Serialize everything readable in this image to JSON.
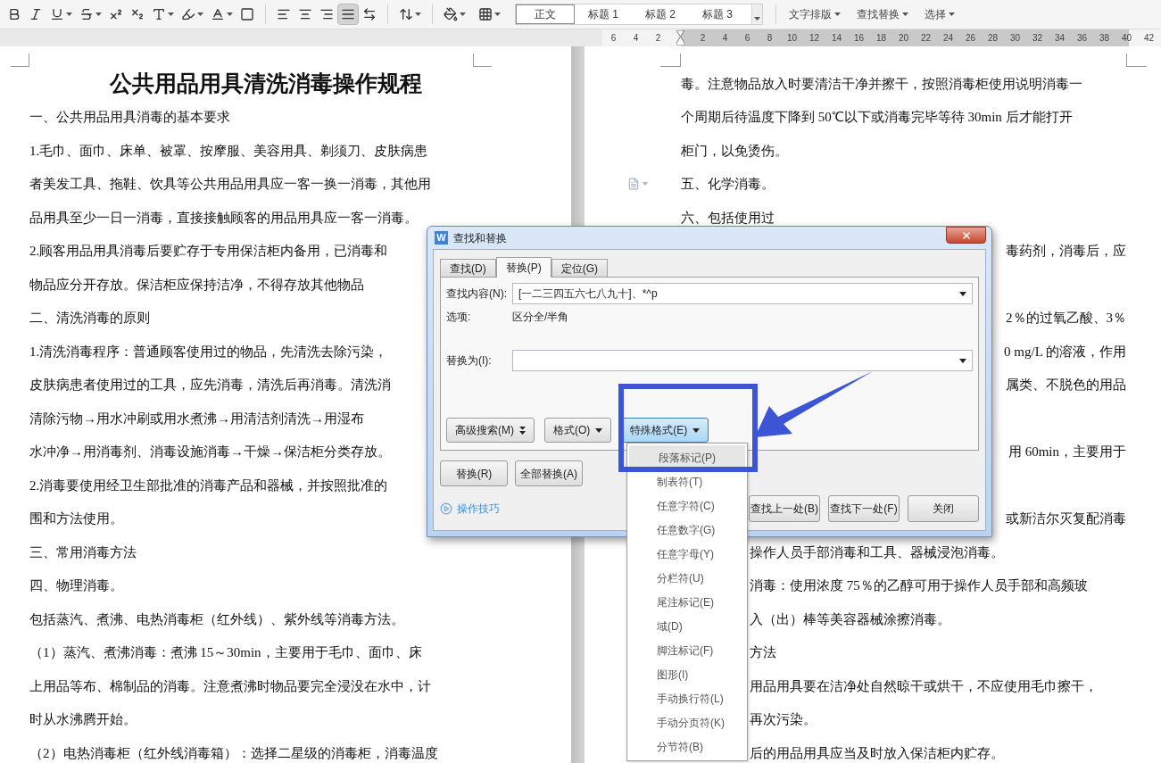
{
  "toolbar": {
    "format_buttons": [
      {
        "kind": "bold"
      },
      {
        "kind": "italic"
      },
      {
        "kind": "underline"
      },
      {
        "kind": "strike"
      },
      {
        "kind": "superscript"
      },
      {
        "kind": "subscript"
      },
      {
        "kind": "outline"
      },
      {
        "kind": "highlight"
      },
      {
        "kind": "font_color"
      },
      {
        "kind": "char_border"
      }
    ],
    "align_buttons": [
      {
        "kind": "left",
        "selected": false
      },
      {
        "kind": "center",
        "selected": false
      },
      {
        "kind": "right",
        "selected": false
      },
      {
        "kind": "justify",
        "selected": true
      },
      {
        "kind": "distribute",
        "selected": false
      }
    ],
    "styles": [
      {
        "label": "正文",
        "selected": true
      },
      {
        "label": "标题 1",
        "selected": false
      },
      {
        "label": "标题 2",
        "selected": false
      },
      {
        "label": "标题 3",
        "selected": false
      }
    ],
    "menus": [
      "文字排版",
      "查找替换",
      "选择"
    ]
  },
  "ruler": {
    "left_ticks": [
      "6",
      "4",
      "2"
    ],
    "right_ticks": [
      "2",
      "4",
      "6",
      "8",
      "10",
      "12",
      "14",
      "16",
      "18",
      "20",
      "22",
      "24",
      "26",
      "28",
      "30",
      "32",
      "34",
      "36",
      "38",
      "40",
      "42"
    ]
  },
  "left_page": {
    "title": "公共用品用具清洗消毒操作规程",
    "lines": [
      "一、公共用品用具消毒的基本要求",
      "1.毛巾、面巾、床单、被罩、按摩服、美容用具、剃须刀、皮肤病患",
      "者美发工具、拖鞋、饮具等公共用品用具应一客一换一消毒，其他用",
      "品用具至少一日一消毒，直接接触顾客的用品用具应一客一消毒。",
      "2.顾客用品用具消毒后要贮存于专用保洁柜内备用，已消毒和",
      "物品应分开存放。保洁柜应保持洁净，不得存放其他物品",
      "二、清洗消毒的原则",
      "1.清洗消毒程序：普通顾客使用过的物品，先清洗去除污染，",
      "皮肤病患者使用过的工具，应先消毒，清洗后再消毒。清洗消",
      "清除污物→用水冲刷或用水煮沸→用清洁剂清洗→用湿布",
      "水冲净→用消毒剂、消毒设施消毒→干燥→保洁柜分类存放。",
      "2.消毒要使用经卫生部批准的消毒产品和器械，并按照批准的",
      "围和方法使用。",
      "三、常用消毒方法",
      "四、物理消毒。",
      "包括蒸汽、煮沸、电热消毒柜（红外线）、紫外线等消毒方法。",
      "（1）蒸汽、煮沸消毒：煮沸 15～30min，主要用于毛巾、面巾、床",
      "上用品等布、棉制品的消毒。注意煮沸时物品要完全浸没在水中，计",
      "时从水沸腾开始。",
      "（2）电热消毒柜（红外线消毒箱）：选择二星级的消毒柜，消毒温度"
    ]
  },
  "right_page": {
    "lines": [
      {
        "kind": "full",
        "text": "毒。注意物品放入时要清洁干净并擦干，按照消毒柜使用说明消毒一"
      },
      {
        "kind": "full",
        "text": "个周期后待温度下降到 50℃以下或消毒完毕等待 30min 后才能打开"
      },
      {
        "kind": "full",
        "text": "柜门，以免烫伤。"
      },
      {
        "kind": "full_with_icon",
        "text": "五、化学消毒。"
      },
      {
        "kind": "full",
        "text": "六、包括使用过"
      },
      {
        "kind": "tail",
        "text": "毒药剂，消毒后，应"
      },
      {
        "kind": "covered"
      },
      {
        "kind": "tail",
        "text": "2％的过氧乙酸、3％"
      },
      {
        "kind": "tail",
        "text": "0 mg/L 的溶液，作用"
      },
      {
        "kind": "tail",
        "text": "属类、不脱色的用品"
      },
      {
        "kind": "covered"
      },
      {
        "kind": "tail",
        "text": "用 60min，主要用于"
      },
      {
        "kind": "covered"
      },
      {
        "kind": "tail",
        "text": "或新洁尔灭复配消毒"
      },
      {
        "kind": "after_menu",
        "text": "操作人员手部消毒和工具、器械浸泡消毒。"
      },
      {
        "kind": "after_menu",
        "text": "消毒：使用浓度 75％的乙醇可用于操作人员手部和高频玻"
      },
      {
        "kind": "after_menu",
        "text": "入（出）棒等美容器械涂擦消毒。"
      },
      {
        "kind": "after_menu",
        "text": "方法"
      },
      {
        "kind": "after_menu",
        "text": "用品用具要在洁净处自然晾干或烘干，不应使用毛巾擦干，"
      },
      {
        "kind": "after_menu",
        "text": "再次污染。"
      },
      {
        "kind": "after_menu",
        "text": "后的用品用具应当及时放入保洁柜内贮存。"
      }
    ]
  },
  "dialog": {
    "logo_letter": "W",
    "title": "查找和替换",
    "tabs": [
      {
        "label": "查找(D)",
        "selected": false
      },
      {
        "label": "替换(P)",
        "selected": true
      },
      {
        "label": "定位(G)",
        "selected": false
      }
    ],
    "find_label": "查找内容(N):",
    "find_value": "[一二三四五六七八九十]、*^p",
    "options_label": "选项:",
    "options_value": "区分全/半角",
    "replace_label": "替换为(I):",
    "tool_buttons": [
      {
        "label": "高级搜索(M)",
        "kind": "double_caret",
        "selected": false
      },
      {
        "label": "格式(O)",
        "kind": "caret",
        "selected": false
      },
      {
        "label": "特殊格式(E)",
        "kind": "caret",
        "selected": true
      }
    ],
    "action_buttons": [
      "替换(R)",
      "全部替换(A)"
    ],
    "tips_link": "操作技巧",
    "nav_buttons": [
      "查找上一处(B)",
      "查找下一处(F)",
      "关闭"
    ]
  },
  "menu": {
    "items": [
      {
        "label": "段落标记(P)",
        "selected": true
      },
      {
        "label": "制表符(T)",
        "selected": false
      },
      {
        "label": "任意字符(C)",
        "selected": false
      },
      {
        "label": "任意数字(G)",
        "selected": false
      },
      {
        "label": "任意字母(Y)",
        "selected": false
      },
      {
        "label": "分栏符(U)",
        "selected": false
      },
      {
        "label": "尾注标记(E)",
        "selected": false
      },
      {
        "label": "域(D)",
        "selected": false
      },
      {
        "label": "脚注标记(F)",
        "selected": false
      },
      {
        "label": "图形(I)",
        "selected": false
      },
      {
        "label": "手动换行符(L)",
        "selected": false
      },
      {
        "label": "手动分页符(K)",
        "selected": false
      },
      {
        "label": "分节符(B)",
        "selected": false
      }
    ]
  }
}
